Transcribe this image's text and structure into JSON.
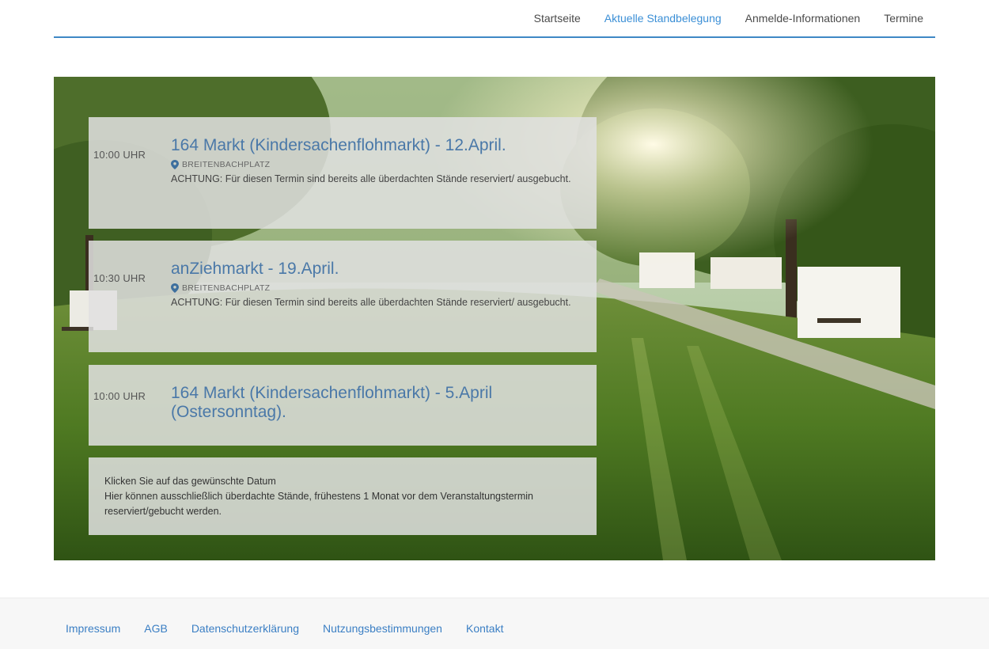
{
  "nav": {
    "items": [
      {
        "label": "Startseite",
        "active": false
      },
      {
        "label": "Aktuelle Standbelegung",
        "active": true
      },
      {
        "label": "Anmelde-Informationen",
        "active": false
      },
      {
        "label": "Termine",
        "active": false
      }
    ]
  },
  "events": [
    {
      "time": "10:00 UHR",
      "title": "164 Markt (Kindersachenflohmarkt) - 12.April.",
      "location": "BREITENBACHPLATZ",
      "note": "ACHTUNG: Für diesen Termin sind bereits alle überdachten Stände reserviert/ ausgebucht."
    },
    {
      "time": "10:30 UHR",
      "title": "anZiehmarkt - 19.April.",
      "location": "BREITENBACHPLATZ",
      "note": "ACHTUNG: Für diesen Termin sind bereits alle überdachten Stände reserviert/ ausgebucht."
    },
    {
      "time": "10:00 UHR",
      "title": "164 Markt (Kindersachenflohmarkt) - 5.April (Ostersonntag).",
      "location": "",
      "note": ""
    }
  ],
  "info": {
    "line1": "Klicken Sie auf das gewünschte Datum",
    "line2": "Hier können ausschließlich überdachte Stände, frühestens 1 Monat vor dem Veranstaltungstermin reserviert/gebucht werden."
  },
  "footer": {
    "links": [
      "Impressum",
      "AGB",
      "Datenschutzerklärung",
      "Nutzungsbestimmungen",
      "Kontakt"
    ]
  },
  "colors": {
    "accent": "#3b8fd6",
    "title_blue": "#4a78a8",
    "footer_link": "#3b7fc4"
  }
}
